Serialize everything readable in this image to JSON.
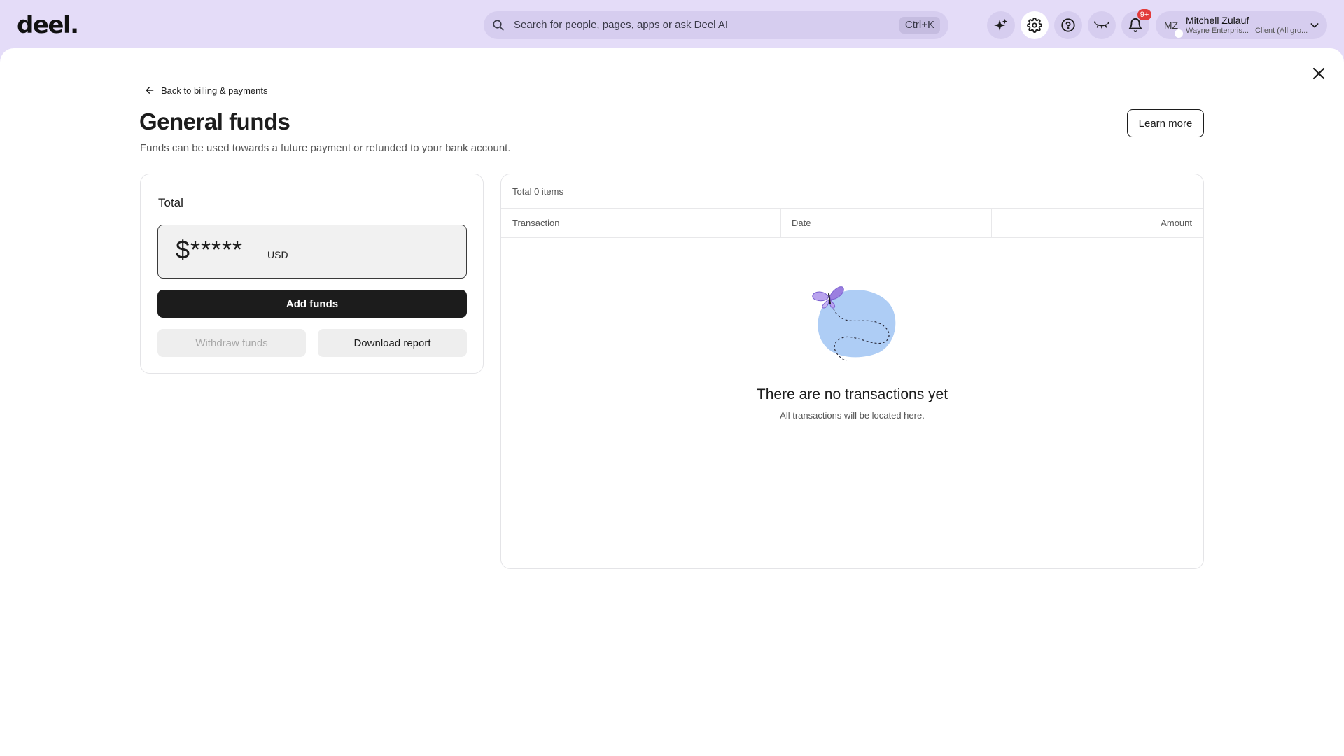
{
  "header": {
    "logo": "deel.",
    "search_placeholder": "Search for people, pages, apps or ask Deel AI",
    "search_shortcut": "Ctrl+K",
    "notifications_badge": "9+",
    "user": {
      "initials": "MZ",
      "name": "Mitchell Zulauf",
      "subtitle": "Wayne Enterpris... | Client (All gro..."
    }
  },
  "page": {
    "back_link": "Back to billing & payments",
    "title": "General funds",
    "subtitle": "Funds can be used towards a future payment or refunded to your bank account.",
    "learn_more": "Learn more"
  },
  "total_card": {
    "title": "Total",
    "amount": "$*****",
    "currency": "USD",
    "add_funds": "Add funds",
    "withdraw_funds": "Withdraw funds",
    "download_report": "Download report"
  },
  "transactions": {
    "count_label": "Total 0 items",
    "columns": [
      "Transaction",
      "Date",
      "Amount"
    ],
    "empty_title": "There are no transactions yet",
    "empty_subtitle": "All transactions will be located here."
  },
  "colors": {
    "header_bg": "#e4dcf8",
    "primary_button": "#1c1c1c",
    "badge": "#e23b3b",
    "illustration_blob": "#aecdf5",
    "butterfly": "#9b7fe0"
  }
}
